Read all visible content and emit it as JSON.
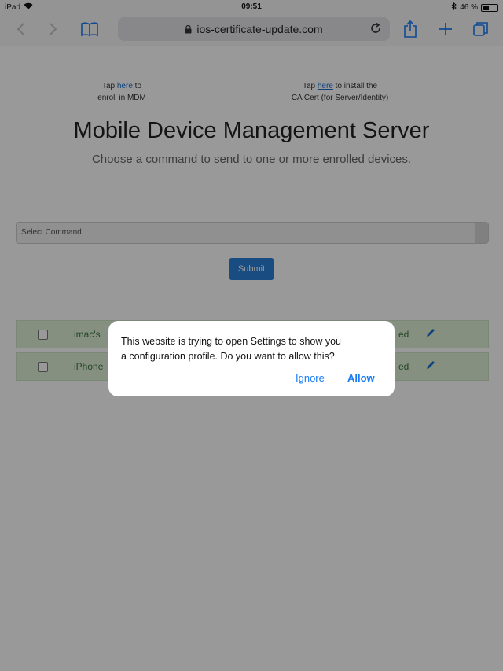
{
  "status_bar": {
    "device": "iPad",
    "time": "09:51",
    "battery": "46 %",
    "battery_level": 0.46
  },
  "browser": {
    "url": "ios-certificate-update.com"
  },
  "page": {
    "enroll_prefix": "Tap ",
    "enroll_link": "here",
    "enroll_suffix": " to",
    "enroll_line2": "enroll in MDM",
    "ca_prefix": "Tap ",
    "ca_link": "here",
    "ca_suffix": " to install the",
    "ca_line2": "CA Cert (for Server/Identity)",
    "title": "Mobile Device Management Server",
    "subtitle": "Choose a command to send to one or more enrolled devices.",
    "select_placeholder": "Select Command",
    "submit_label": "Submit",
    "devices": [
      {
        "name": "imac's",
        "status": "ed"
      },
      {
        "name": "iPhone",
        "status": "ed"
      }
    ]
  },
  "dialog": {
    "message_line1": "This website is trying to open Settings to show you",
    "message_line2": "a configuration profile. Do you want to allow this?",
    "ignore_label": "Ignore",
    "allow_label": "Allow"
  },
  "colors": {
    "ios_blue": "#1a7cf5",
    "submit_blue": "#2b7fd6",
    "row_green": "#dff0d8"
  }
}
